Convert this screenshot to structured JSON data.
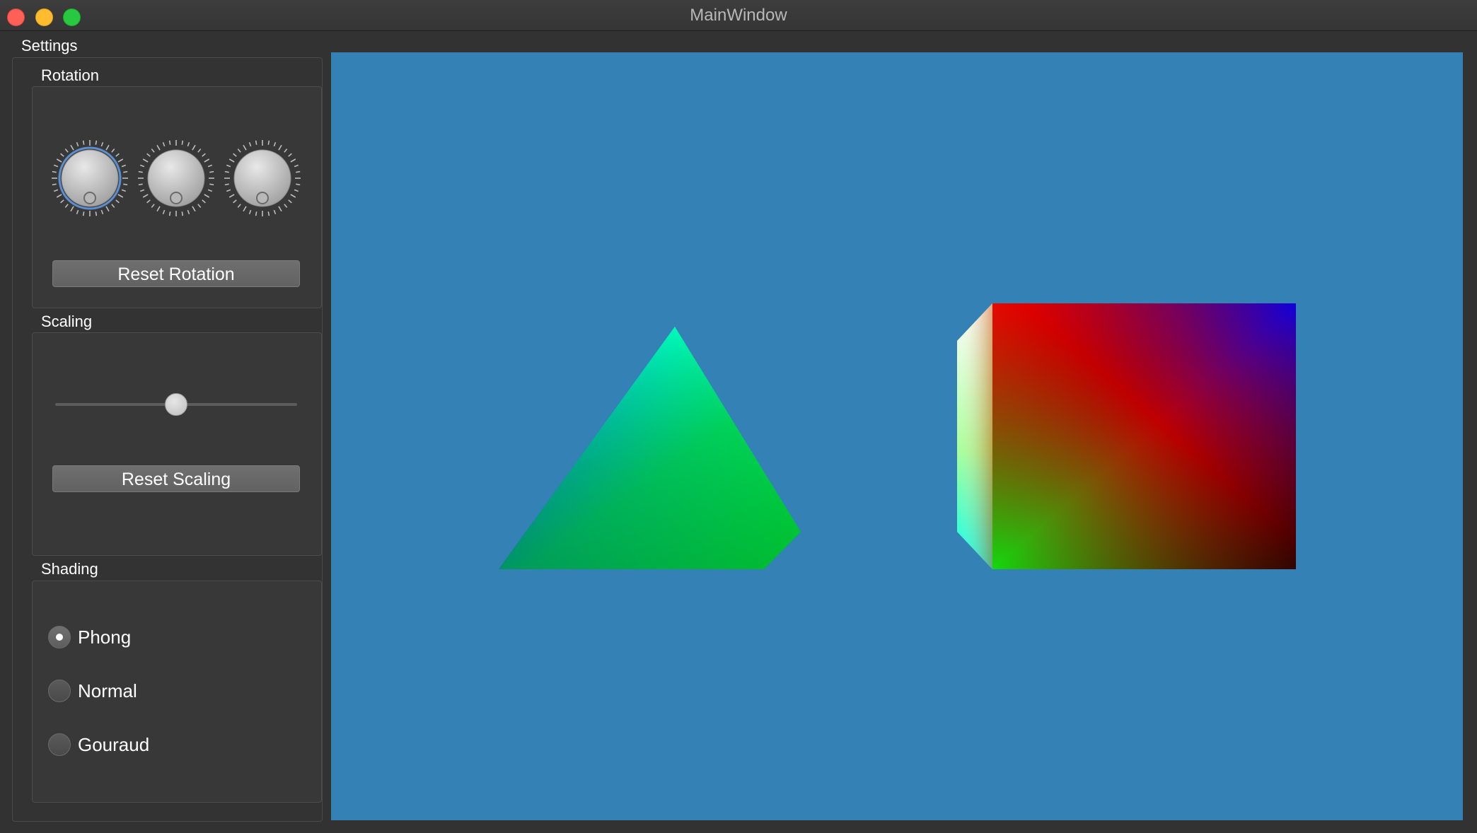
{
  "window": {
    "title": "MainWindow"
  },
  "menu": {
    "settings_label": "Settings"
  },
  "rotation": {
    "title": "Rotation",
    "reset_label": "Reset Rotation",
    "dials": [
      {
        "name": "x",
        "focused": true
      },
      {
        "name": "y",
        "focused": false
      },
      {
        "name": "z",
        "focused": false
      }
    ]
  },
  "scaling": {
    "title": "Scaling",
    "reset_label": "Reset Scaling",
    "slider_value_fraction": 0.5
  },
  "shading": {
    "title": "Shading",
    "options": [
      {
        "label": "Phong",
        "checked": true
      },
      {
        "label": "Normal",
        "checked": false
      },
      {
        "label": "Gouraud",
        "checked": false
      }
    ]
  },
  "scene": {
    "background_color": "#3381b5",
    "objects": [
      "pyramid",
      "cube"
    ]
  }
}
